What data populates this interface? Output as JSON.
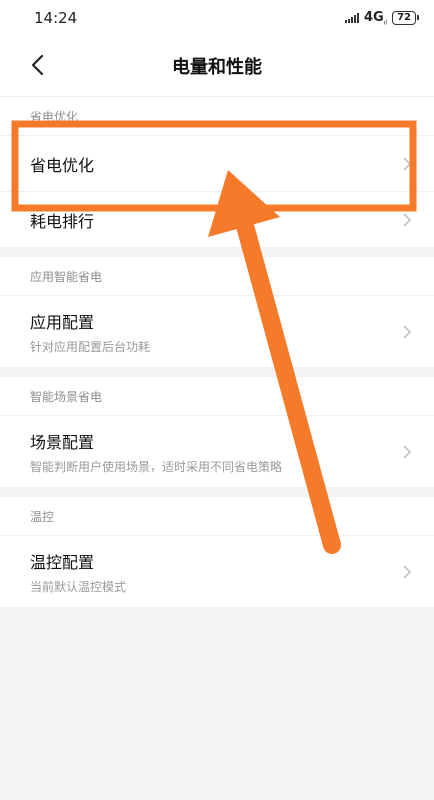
{
  "status_bar": {
    "time": "14:24",
    "network": "4G",
    "network_sub": "ıl",
    "battery": "72"
  },
  "header": {
    "title": "电量和性能",
    "back_icon": "chevron-left-icon"
  },
  "sections": [
    {
      "label": "省电优化",
      "items": [
        {
          "title": "省电优化"
        },
        {
          "title": "耗电排行"
        }
      ]
    },
    {
      "label": "应用智能省电",
      "items": [
        {
          "title": "应用配置",
          "subtitle": "针对应用配置后台功耗"
        }
      ]
    },
    {
      "label": "智能场景省电",
      "items": [
        {
          "title": "场景配置",
          "subtitle": "智能判断用户使用场景，适时采用不同省电策略"
        }
      ]
    },
    {
      "label": "温控",
      "items": [
        {
          "title": "温控配置",
          "subtitle": "当前默认温控模式"
        }
      ]
    }
  ],
  "annotation": {
    "highlight_color": "#f57a2a",
    "arrow_color": "#f57a2a",
    "arrow_icon": "arrow-up-icon"
  },
  "colors": {
    "background": "#f4f2f5",
    "card": "#ffffff",
    "text_primary": "#111111",
    "text_secondary": "#9a9a9a"
  }
}
